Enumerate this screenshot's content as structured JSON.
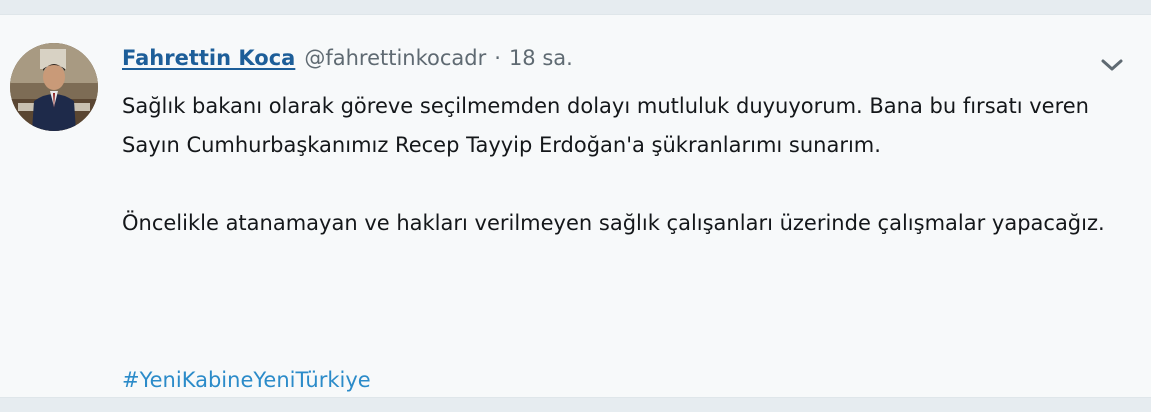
{
  "tweet": {
    "author": {
      "display_name": "Fahrettin Koca",
      "handle": "@fahrettinkocadr"
    },
    "separator": "·",
    "timestamp": "18 sa.",
    "paragraphs": [
      "Sağlık bakanı olarak göreve seçilmemden dolayı mutluluk duyuyorum. Bana bu fırsatı veren Sayın Cumhurbaşkanımız Recep Tayyip Erdoğan'a şükranlarımı sunarım.",
      "Öncelikle atanamayan ve hakları verilmeyen sağlık çalışanları üzerinde çalışmalar yapacağız."
    ],
    "hashtag": "#YeniKabineYeniTürkiye",
    "icons": {
      "more": "chevron-down-icon"
    },
    "colors": {
      "name": "#1d5e99",
      "hashtag": "#2b8bc9",
      "text": "#14171a",
      "muted": "#5f6a72",
      "card_background": "#f7f9fa"
    }
  }
}
